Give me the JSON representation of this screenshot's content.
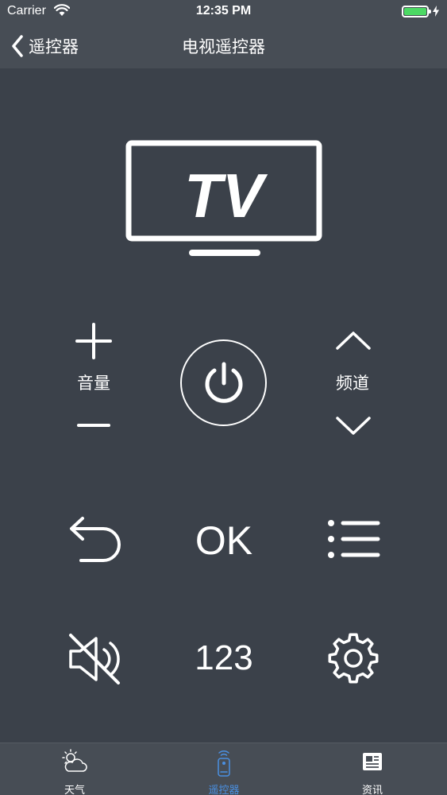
{
  "status_bar": {
    "carrier": "Carrier",
    "time": "12:35 PM",
    "battery_level": 1.0,
    "battery_color": "#4cd964"
  },
  "nav": {
    "back_label": "遥控器",
    "title": "电视遥控器",
    "back_icon": "chevron-left-icon"
  },
  "tv_logo_text": "TV",
  "controls": {
    "volume_label": "音量",
    "channel_label": "频道",
    "ok_label": "OK",
    "number_label": "123",
    "icons": [
      "plus-icon",
      "minus-icon",
      "power-icon",
      "chevron-up-icon",
      "chevron-down-icon",
      "back-arrow-icon",
      "menu-list-icon",
      "mute-icon",
      "gear-icon"
    ]
  },
  "tabs": [
    {
      "label": "天气",
      "icon": "weather-icon",
      "active": false
    },
    {
      "label": "遥控器",
      "icon": "remote-icon",
      "active": true
    },
    {
      "label": "资讯",
      "icon": "news-icon",
      "active": false
    }
  ],
  "colors": {
    "background": "#3b414a",
    "bar": "#474d55",
    "active_tab": "#4a90e2",
    "inactive_tab": "#ffffff"
  }
}
